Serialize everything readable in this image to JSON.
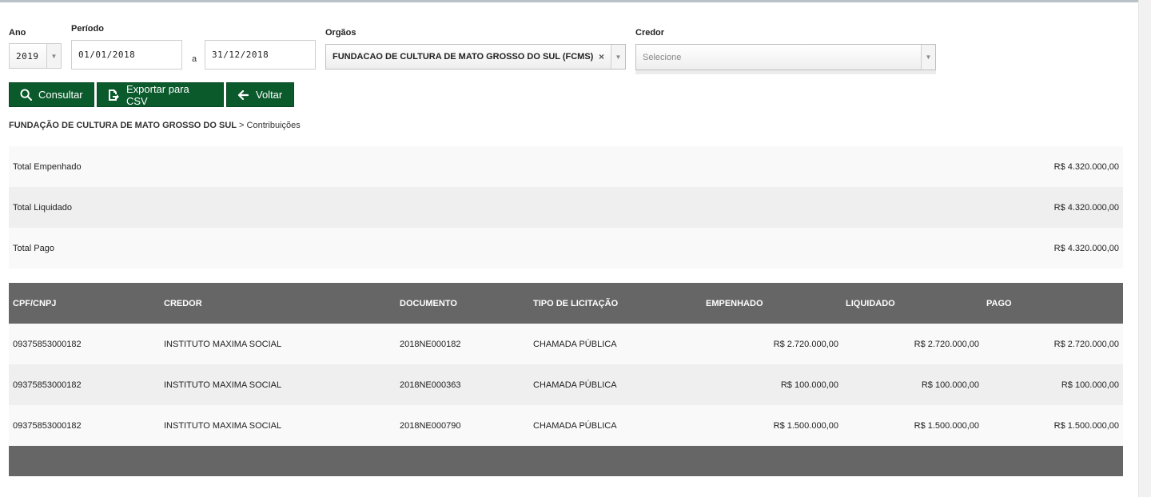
{
  "filters": {
    "ano_label": "Ano",
    "ano_value": "2019",
    "periodo_label": "Período",
    "data_inicio": "01/01/2018",
    "periodo_sep": "a",
    "data_fim": "31/12/2018",
    "orgaos_label": "Orgãos",
    "orgao_value": "FUNDACAO DE CULTURA DE MATO GROSSO DO SUL (FCMS)",
    "orgao_clear": "×",
    "credor_label": "Credor",
    "credor_placeholder": "Selecione"
  },
  "buttons": {
    "consultar": "Consultar",
    "exportar": "Exportar para CSV",
    "voltar": "Voltar"
  },
  "breadcrumb": {
    "orgao": "FUNDAÇÃO DE CULTURA DE MATO GROSSO DO SUL",
    "sep": " > ",
    "page": "Contribuições"
  },
  "totals": [
    {
      "label": "Total Empenhado",
      "value": "R$ 4.320.000,00"
    },
    {
      "label": "Total Liquidado",
      "value": "R$ 4.320.000,00"
    },
    {
      "label": "Total Pago",
      "value": "R$ 4.320.000,00"
    }
  ],
  "table": {
    "headers": {
      "cpf": "CPF/CNPJ",
      "credor": "CREDOR",
      "documento": "DOCUMENTO",
      "tipo": "TIPO DE LICITAÇÃO",
      "empenhado": "EMPENHADO",
      "liquidado": "LIQUIDADO",
      "pago": "PAGO"
    },
    "rows": [
      {
        "cpf": "09375853000182",
        "credor": "INSTITUTO MAXIMA SOCIAL",
        "documento": "2018NE000182",
        "tipo": "CHAMADA PÚBLICA",
        "empenhado": "R$ 2.720.000,00",
        "liquidado": "R$ 2.720.000,00",
        "pago": "R$ 2.720.000,00"
      },
      {
        "cpf": "09375853000182",
        "credor": "INSTITUTO MAXIMA SOCIAL",
        "documento": "2018NE000363",
        "tipo": "CHAMADA PÚBLICA",
        "empenhado": "R$ 100.000,00",
        "liquidado": "R$ 100.000,00",
        "pago": "R$ 100.000,00"
      },
      {
        "cpf": "09375853000182",
        "credor": "INSTITUTO MAXIMA SOCIAL",
        "documento": "2018NE000790",
        "tipo": "CHAMADA PÚBLICA",
        "empenhado": "R$ 1.500.000,00",
        "liquidado": "R$ 1.500.000,00",
        "pago": "R$ 1.500.000,00"
      }
    ]
  },
  "icons": {
    "search": "search-icon",
    "export": "export-icon",
    "back": "arrow-left-icon",
    "dropdown": "chevron-down-icon"
  },
  "colors": {
    "primary_button": "#0b5a2c",
    "table_header": "#666666"
  }
}
